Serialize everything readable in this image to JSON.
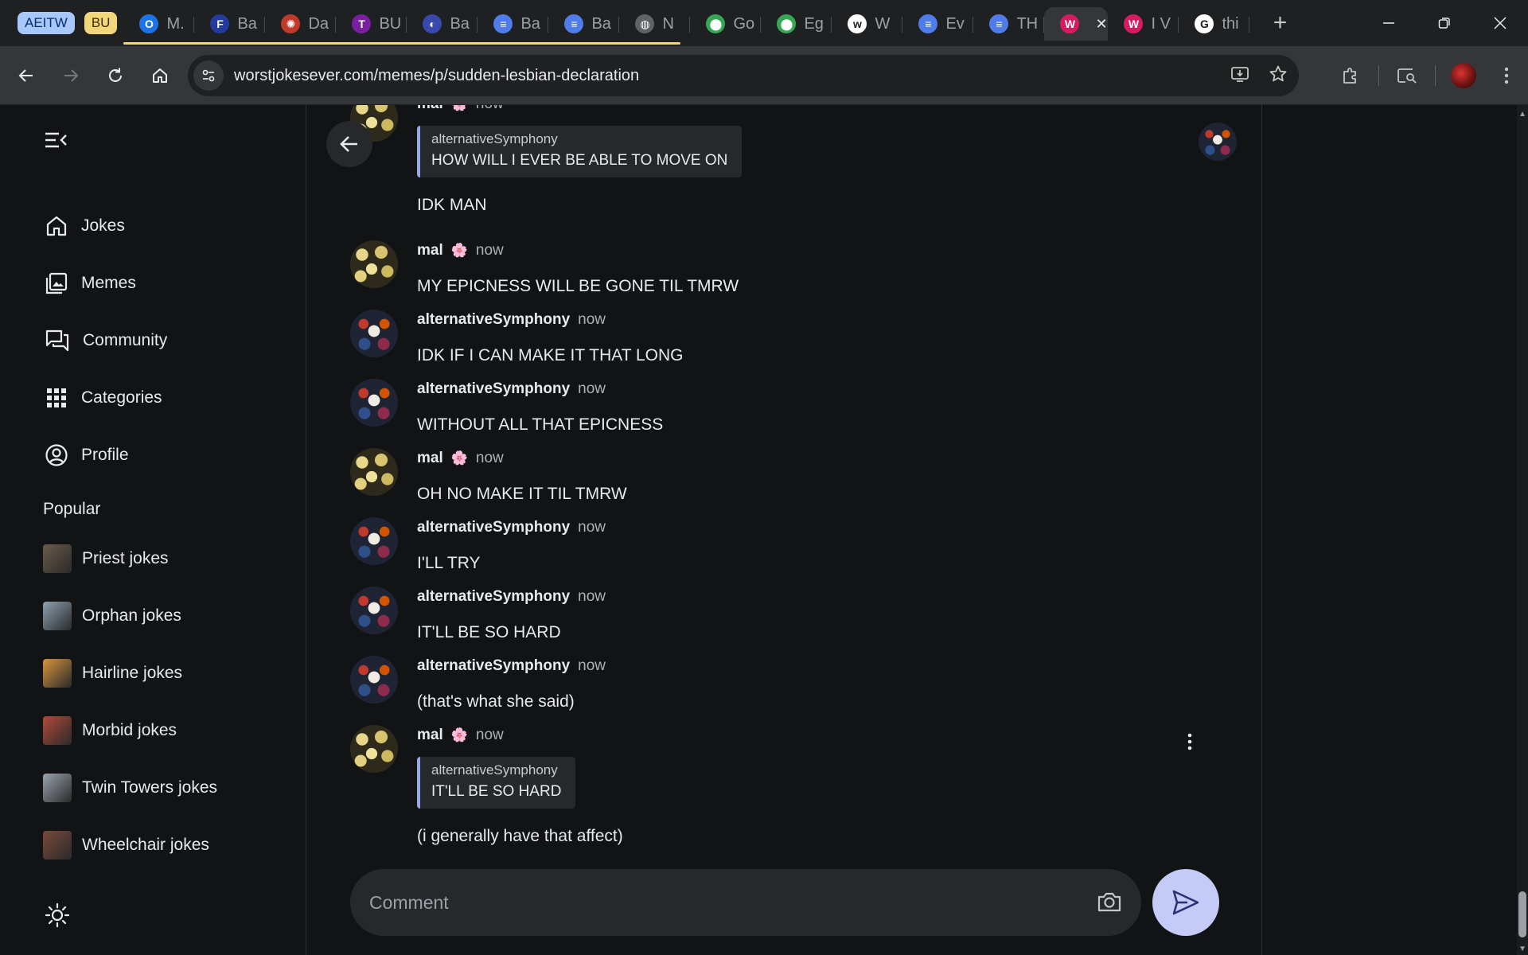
{
  "browser": {
    "tab_groups": [
      {
        "label": "AEITW",
        "bg": "#a8c7fa",
        "fg": "#062e6f"
      },
      {
        "label": "BU",
        "bg": "#f1d67a",
        "fg": "#3d2e00"
      }
    ],
    "tabs": [
      {
        "title": "M.",
        "icon": "outlook-icon",
        "color": "#1a73e8",
        "glyph": "O"
      },
      {
        "title": "Ba",
        "icon": "app-icon",
        "color": "#233a9e",
        "glyph": "F"
      },
      {
        "title": "Da",
        "icon": "app-icon",
        "color": "#c0392b",
        "glyph": "✺"
      },
      {
        "title": "BU",
        "icon": "app-icon",
        "color": "#7b1fa2",
        "glyph": "T"
      },
      {
        "title": "Ba",
        "icon": "app-icon",
        "color": "#3949ab",
        "glyph": "◐"
      },
      {
        "title": "Ba",
        "icon": "docs-icon",
        "color": "#4f7ce8",
        "glyph": "≡"
      },
      {
        "title": "Ba",
        "icon": "docs-icon",
        "color": "#4f7ce8",
        "glyph": "≡"
      },
      {
        "title": "N",
        "icon": "globe-icon",
        "color": "#5f6368",
        "glyph": "◍"
      },
      {
        "title": "Go",
        "icon": "maps-icon",
        "color": "#34a853",
        "glyph": "⬤"
      },
      {
        "title": "Eg",
        "icon": "maps-icon",
        "color": "#34a853",
        "glyph": "⬤"
      },
      {
        "title": "W",
        "icon": "app-icon",
        "color": "#ffffff",
        "glyph": "w"
      },
      {
        "title": "Ev",
        "icon": "docs-icon",
        "color": "#4f7ce8",
        "glyph": "≡"
      },
      {
        "title": "TH",
        "icon": "docs-icon",
        "color": "#4f7ce8",
        "glyph": "≡"
      },
      {
        "title": "",
        "icon": "site-icon",
        "color": "#d81b60",
        "glyph": "W",
        "active": true
      },
      {
        "title": "I V",
        "icon": "site-icon",
        "color": "#d81b60",
        "glyph": "W"
      },
      {
        "title": "thi",
        "icon": "google-icon",
        "color": "#ffffff",
        "glyph": "G"
      }
    ],
    "url_host": "worstjokesever.com",
    "url_path": "/memes/p/sudden-lesbian-declaration"
  },
  "sidebar": {
    "nav": [
      {
        "label": "Jokes",
        "icon": "home-icon"
      },
      {
        "label": "Memes",
        "icon": "images-icon"
      },
      {
        "label": "Community",
        "icon": "chat-icon"
      },
      {
        "label": "Categories",
        "icon": "grid-icon"
      },
      {
        "label": "Profile",
        "icon": "profile-icon"
      }
    ],
    "popular_title": "Popular",
    "popular": [
      {
        "label": "Priest jokes",
        "color": "#6b5b4a"
      },
      {
        "label": "Orphan jokes",
        "color": "#8ca0b0"
      },
      {
        "label": "Hairline jokes",
        "color": "#d8943a"
      },
      {
        "label": "Morbid jokes",
        "color": "#b24a3a"
      },
      {
        "label": "Twin Towers jokes",
        "color": "#9aa3ad"
      },
      {
        "label": "Wheelchair jokes",
        "color": "#7a4a3a"
      }
    ]
  },
  "chat": {
    "messages": [
      {
        "author": "mal",
        "flower": "🌸",
        "time": "now",
        "avatar": "mal",
        "quote": {
          "author": "alternativeSymphony",
          "text": "HOW WILL I EVER BE ABLE TO MOVE ON"
        },
        "text": "IDK MAN"
      },
      {
        "author": "mal",
        "flower": "🌸",
        "time": "now",
        "avatar": "mal",
        "text": "MY EPICNESS WILL BE GONE TIL TMRW"
      },
      {
        "author": "alternativeSymphony",
        "time": "now",
        "avatar": "alt",
        "text": "IDK IF I CAN MAKE IT THAT LONG"
      },
      {
        "author": "alternativeSymphony",
        "time": "now",
        "avatar": "alt",
        "text": "WITHOUT ALL THAT EPICNESS"
      },
      {
        "author": "mal",
        "flower": "🌸",
        "time": "now",
        "avatar": "mal",
        "text": "OH NO MAKE IT TIL TMRW"
      },
      {
        "author": "alternativeSymphony",
        "time": "now",
        "avatar": "alt",
        "text": "I'LL TRY"
      },
      {
        "author": "alternativeSymphony",
        "time": "now",
        "avatar": "alt",
        "text": "IT'LL BE SO HARD"
      },
      {
        "author": "alternativeSymphony",
        "time": "now",
        "avatar": "alt",
        "text": "(that's what she said)"
      },
      {
        "author": "mal",
        "flower": "🌸",
        "time": "now",
        "avatar": "mal",
        "quote": {
          "author": "alternativeSymphony",
          "text": "IT'LL BE SO HARD"
        },
        "text": "(i generally have that affect)"
      }
    ],
    "composer_placeholder": "Comment"
  }
}
